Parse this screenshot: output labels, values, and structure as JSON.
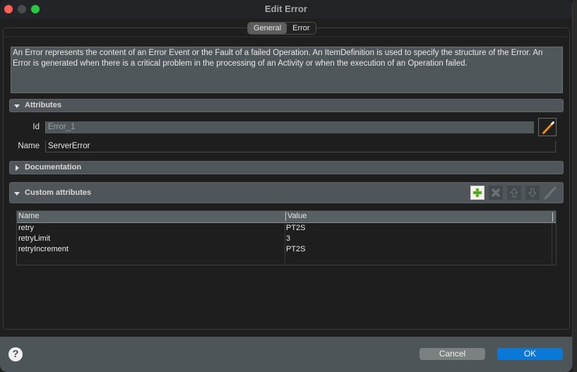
{
  "window": {
    "title": "Edit Error"
  },
  "tabs": [
    {
      "label": "General",
      "active": true
    },
    {
      "label": "Error",
      "active": false
    }
  ],
  "description": "An Error represents the content of an Error Event or the Fault of a failed Operation. An ItemDefinition is used to specify the structure of the Error. An Error is generated when there is a critical problem in the processing of an Activity or when the execution of an Operation failed.",
  "sections": {
    "attributes": {
      "label": "Attributes",
      "expanded": true
    },
    "documentation": {
      "label": "Documentation",
      "expanded": false
    },
    "custom": {
      "label": "Custom attributes",
      "expanded": true
    }
  },
  "attributes": {
    "id_label": "Id",
    "id_value": "Error_1",
    "name_label": "Name",
    "name_value": "ServerError"
  },
  "custom_toolbar": {
    "icons": [
      "add-icon",
      "delete-icon",
      "move-up-icon",
      "move-down-icon",
      "edit-icon"
    ]
  },
  "custom_table": {
    "columns": [
      "Name",
      "Value"
    ],
    "rows": [
      {
        "name": "retry",
        "value": "PT2S"
      },
      {
        "name": "retryLimit",
        "value": "3"
      },
      {
        "name": "retryIncrement",
        "value": "PT2S"
      }
    ]
  },
  "footer": {
    "help_glyph": "?",
    "cancel_label": "Cancel",
    "ok_label": "OK"
  },
  "colors": {
    "accent": "#0a78d7",
    "close": "#fe5f57",
    "maximize": "#28c840",
    "add_icon": "#3aa52e",
    "edit_pencil": "#f08a1c"
  }
}
